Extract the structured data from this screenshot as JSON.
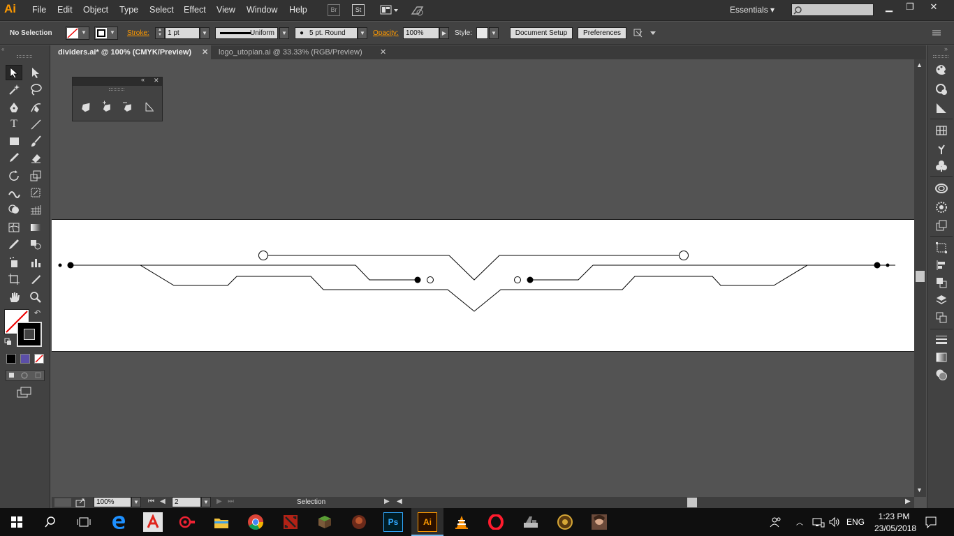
{
  "app": {
    "logo_text": "Ai",
    "menu": [
      "File",
      "Edit",
      "Object",
      "Type",
      "Select",
      "Effect",
      "View",
      "Window",
      "Help"
    ],
    "bridge_label": "Br",
    "stock_label": "St",
    "workspace": "Essentials",
    "accent_color": "#ff9a00"
  },
  "control": {
    "selection_state": "No Selection",
    "stroke_label": "Stroke:",
    "stroke_weight": "1 pt",
    "profile": "Uniform",
    "brush": "5 pt. Round",
    "opacity_label": "Opacity:",
    "opacity_value": "100%",
    "style_label": "Style:",
    "document_setup": "Document Setup",
    "preferences": "Preferences"
  },
  "tabs": [
    {
      "label": "dividers.ai* @ 100% (CMYK/Preview)",
      "active": true
    },
    {
      "label": "logo_utopian.ai @ 33.33% (RGB/Preview)",
      "active": false
    }
  ],
  "status": {
    "zoom": "100%",
    "artboard_number": "2",
    "tool_name": "Selection"
  },
  "taskbar": {
    "language": "ENG",
    "time": "1:23 PM",
    "date": "23/05/2018"
  }
}
